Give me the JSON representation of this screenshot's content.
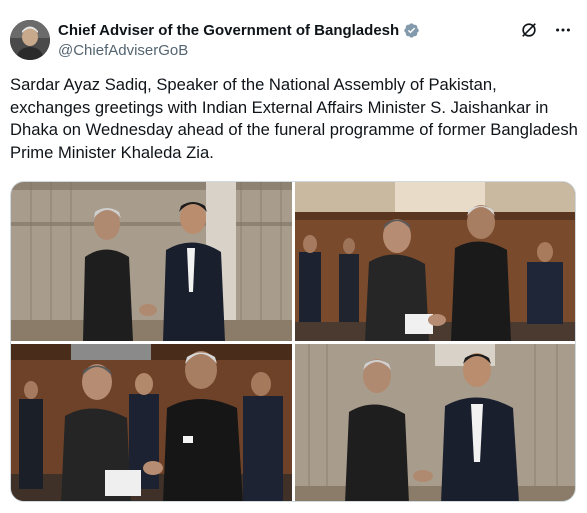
{
  "post": {
    "author_name": "Chief Adviser of the Government of Bangladesh",
    "handle": "@ChiefAdviserGoB",
    "verified": true,
    "text": "Sardar Ayaz Sadiq, Speaker of the National Assembly of Pakistan, exchanges greetings with Indian External Affairs Minister S. Jaishankar in Dhaka on Wednesday ahead of the funeral programme of former Bangladesh Prime Minister Khaleda Zia.",
    "photo_count": 4
  },
  "icons": {
    "grok": "grok-icon",
    "more": "more-icon",
    "verified": "verified-badge-icon"
  },
  "colors": {
    "text": "#0f1419",
    "secondary": "#536471",
    "verified_badge": "#829aab",
    "border": "#cfd9de"
  }
}
